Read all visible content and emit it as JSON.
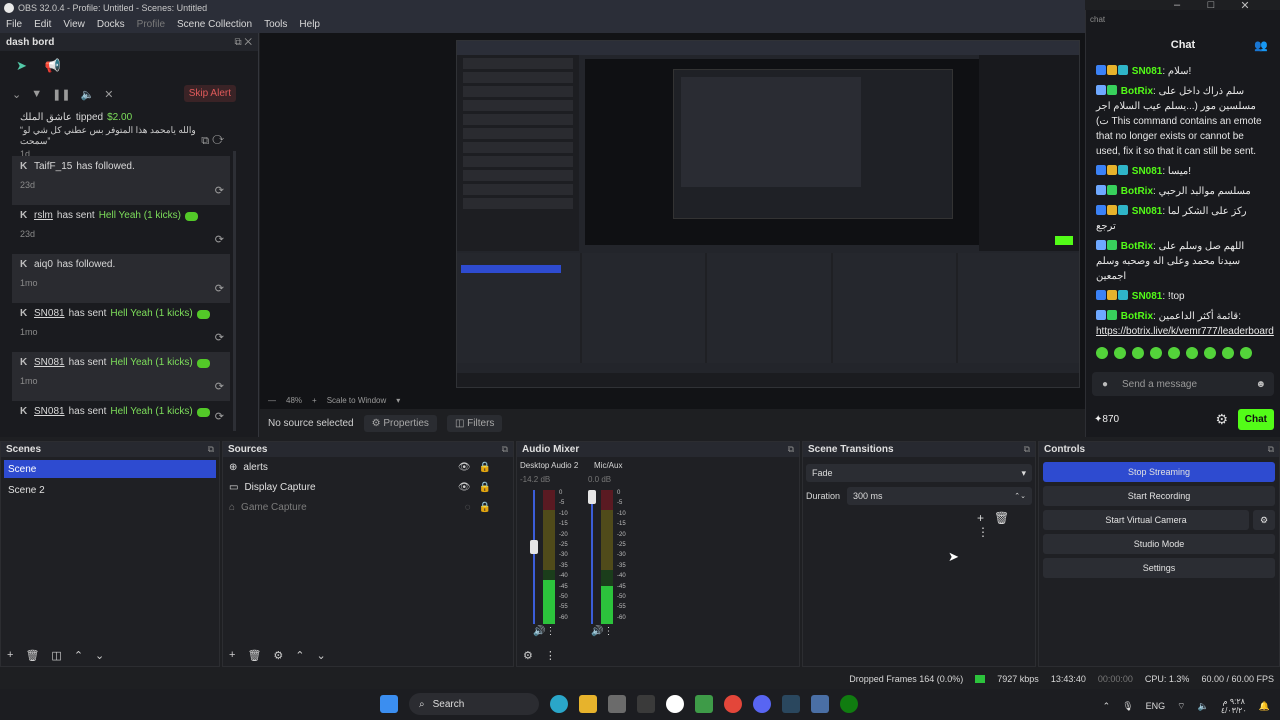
{
  "window": {
    "title": "OBS 32.0.4 - Profile: Untitled - Scenes: Untitled"
  },
  "menu": [
    "File",
    "Edit",
    "View",
    "Docks",
    "Profile",
    "Scene Collection",
    "Tools",
    "Help"
  ],
  "dash": {
    "title": "dash bord",
    "skip_label": "Skip Alert",
    "alerts": [
      {
        "name": "عاشق الملك",
        "action": "tipped",
        "amount": "$2.00",
        "message": "“والله يامحمد هذا المتوفر بس عطني كل شي لو سمحت”",
        "time": "1d"
      },
      {
        "name": "TaifF_15",
        "action": "has followed.",
        "time": "23d"
      },
      {
        "name": "rslm",
        "action": "has sent",
        "gift": "Hell Yeah (1 kicks)",
        "time": "23d"
      },
      {
        "name": "aiq0",
        "action": "has followed.",
        "time": "1mo"
      },
      {
        "name": "SN081",
        "action": "has sent",
        "gift": "Hell Yeah (1 kicks)",
        "time": "1mo"
      },
      {
        "name": "SN081",
        "action": "has sent",
        "gift": "Hell Yeah (1 kicks)",
        "time": "1mo"
      },
      {
        "name": "SN081",
        "action": "has sent",
        "gift": "Hell Yeah (1 kicks)",
        "time": "1mo"
      }
    ]
  },
  "preview": {
    "zoom": "48%",
    "scale_mode": "Scale to Window"
  },
  "source_bar": {
    "status": "No source selected",
    "properties": "Properties",
    "filters": "Filters"
  },
  "chat": {
    "dock_title": "chat",
    "header": "Chat",
    "messages": [
      {
        "user": "SN081",
        "text": "سلام!"
      },
      {
        "user": "BotRix",
        "text": "سلم ذراك داخل على مسلسين مور (...يسلم عيب السلام اجر ت) This command contains an emote that no longer exists or cannot be used, fix it so that it can still be sent."
      },
      {
        "user": "SN081",
        "text": "ميسا!"
      },
      {
        "user": "BotRix",
        "text": "مسلسم موالبد الرحبي"
      },
      {
        "user": "SN081",
        "text": "ركز على الشكر لما ترجع"
      },
      {
        "user": "BotRix",
        "text": "اللهم صل وسلم على سيدنا محمد وعلى اله وصحبه وسلم اجمعين"
      },
      {
        "user": "SN081",
        "text": "!top"
      },
      {
        "user": "BotRix",
        "text": "قائمة أكثر الداعمين:",
        "link": "https://botrix.live/k/vemr777/leaderboard"
      }
    ],
    "input_placeholder": "Send a message",
    "points": "870",
    "chat_button": "Chat"
  },
  "scenes": {
    "title": "Scenes",
    "items": [
      "Scene",
      "Scene 2"
    ],
    "selected": 0
  },
  "sources": {
    "title": "Sources",
    "items": [
      "alerts",
      "Display Capture",
      "Game Capture"
    ]
  },
  "mixer": {
    "title": "Audio Mixer",
    "channels": [
      {
        "name": "Desktop Audio 2",
        "db": "-14.2 dB"
      },
      {
        "name": "Mic/Aux",
        "db": "0.0 dB"
      }
    ],
    "scale": [
      "0",
      "-5",
      "-10",
      "-15",
      "-20",
      "-25",
      "-30",
      "-35",
      "-40",
      "-45",
      "-50",
      "-55",
      "-60"
    ]
  },
  "transitions": {
    "title": "Scene Transitions",
    "selected": "Fade",
    "duration_label": "Duration",
    "duration": "300 ms"
  },
  "controls": {
    "title": "Controls",
    "buttons": [
      "Stop Streaming",
      "Start Recording",
      "Start Virtual Camera",
      "Studio Mode",
      "Settings"
    ]
  },
  "status": {
    "dropped": "Dropped Frames 164 (0.0%)",
    "bitrate": "7927 kbps",
    "stream_time": "13:43:40",
    "rec_time": "00:00:00",
    "cpu": "CPU: 1.3%",
    "fps": "60.00 / 60.00 FPS"
  },
  "taskbar": {
    "search": "Search",
    "lang": "ENG",
    "time": "٩:٢٨ م",
    "date": "٤/٠٣/٢٠"
  },
  "colors": {
    "accent": "#2e4bd0",
    "kick_green": "#53fc18",
    "skip": "#e05a5a"
  }
}
